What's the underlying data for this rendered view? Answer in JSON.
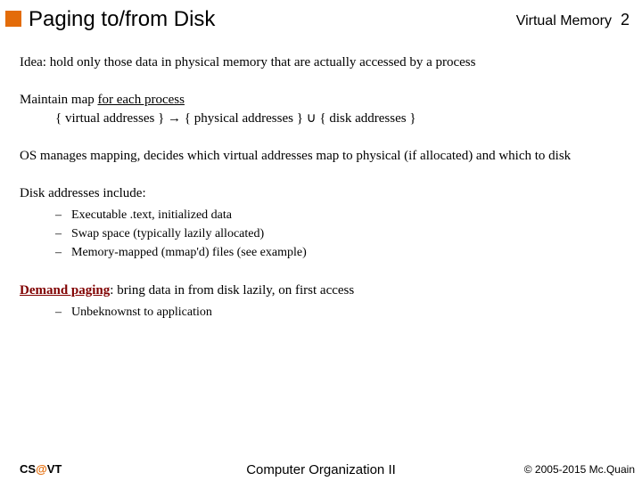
{
  "header": {
    "title": "Paging to/from Disk",
    "section": "Virtual Memory",
    "page": "2"
  },
  "body": {
    "idea": "Idea: hold only those data in physical memory that are actually accessed by a process",
    "maintain_prefix": "Maintain map ",
    "maintain_underline": "for each process",
    "map_line": "{ virtual addresses } → { physical addresses } ∪ { disk addresses }",
    "os_line": "OS manages mapping, decides which virtual addresses map to physical (if allocated) and which to disk",
    "disk_heading": "Disk addresses include:",
    "disk_items": [
      "Executable .text, initialized data",
      "Swap space (typically lazily allocated)",
      "Memory-mapped (mmap'd) files (see example)"
    ],
    "demand_label": "Demand paging",
    "demand_rest": ": bring data in from disk lazily, on first access",
    "demand_items": [
      "Unbeknownst to application"
    ]
  },
  "footer": {
    "left_cs": "CS",
    "left_at": "@",
    "left_vt": "VT",
    "center": "Computer Organization II",
    "right": "© 2005-2015 Mc.Quain"
  }
}
